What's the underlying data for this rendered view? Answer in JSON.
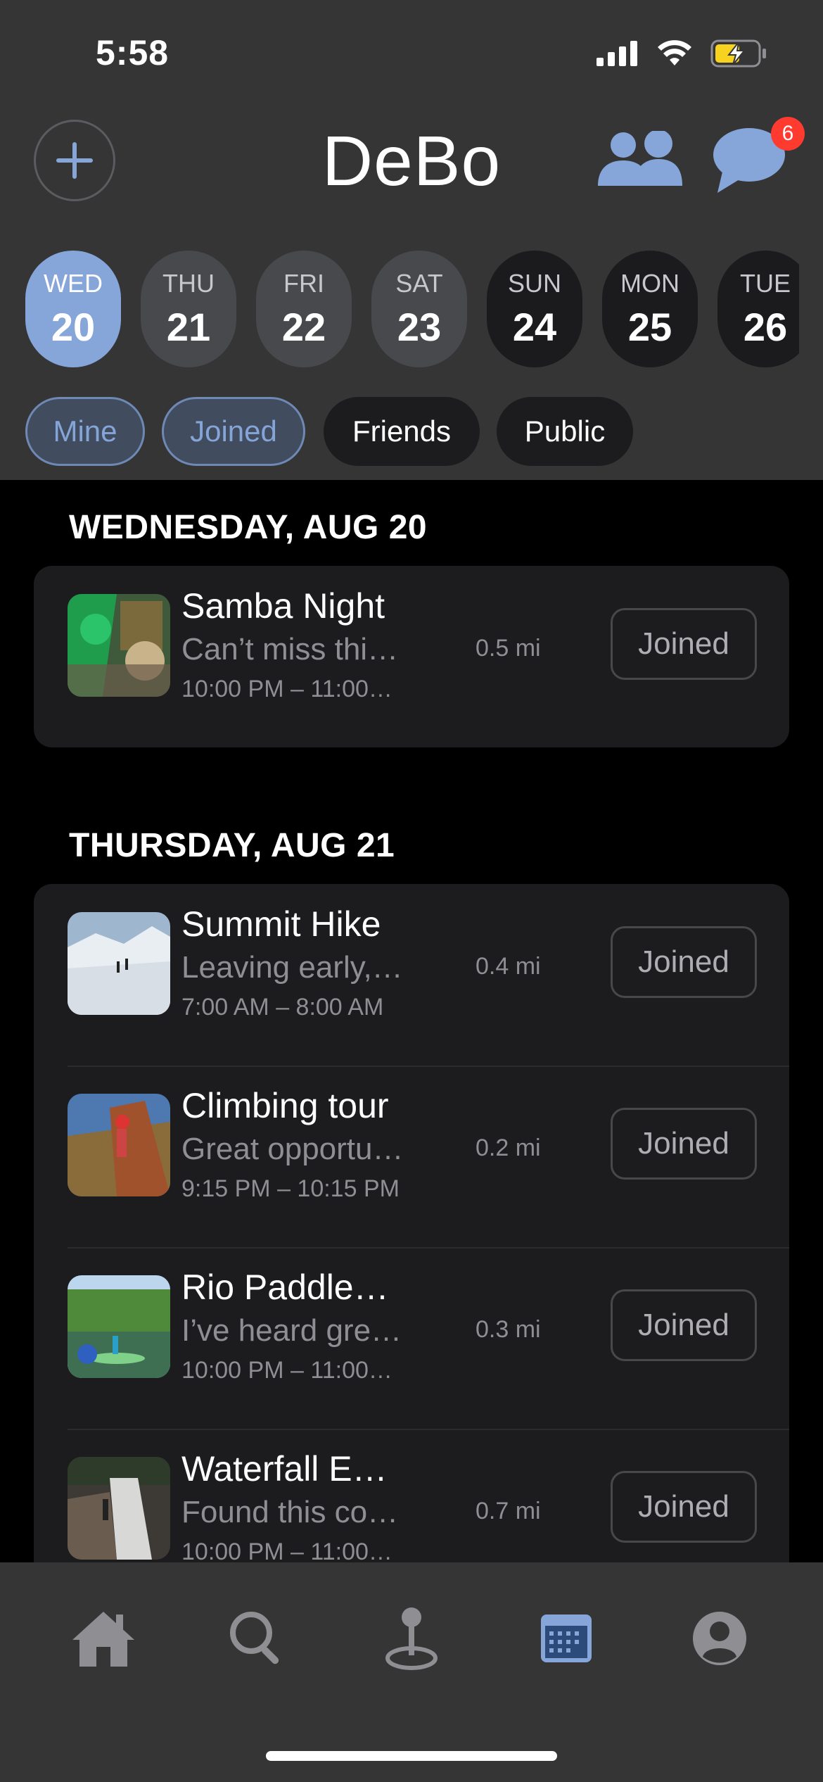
{
  "status_bar": {
    "time": "5:58"
  },
  "header": {
    "title": "DeBo",
    "message_badge": "6"
  },
  "days": [
    {
      "dow": "WED",
      "num": "20"
    },
    {
      "dow": "THU",
      "num": "21"
    },
    {
      "dow": "FRI",
      "num": "22"
    },
    {
      "dow": "SAT",
      "num": "23"
    },
    {
      "dow": "SUN",
      "num": "24"
    },
    {
      "dow": "MON",
      "num": "25"
    },
    {
      "dow": "TUE",
      "num": "26"
    }
  ],
  "filters": [
    "Mine",
    "Joined",
    "Friends",
    "Public"
  ],
  "sections": [
    {
      "title": "WEDNESDAY, AUG 20",
      "events": [
        {
          "title": "Samba Night",
          "desc": "Can’t miss thi…",
          "time": "10:00 PM – 11:00…",
          "distance": "0.5 mi",
          "status": "Joined"
        }
      ]
    },
    {
      "title": "THURSDAY, AUG 21",
      "events": [
        {
          "title": "Summit Hike",
          "desc": "Leaving early,…",
          "time": "7:00 AM – 8:00 AM",
          "distance": "0.4 mi",
          "status": "Joined"
        },
        {
          "title": "Climbing tour",
          "desc": "Great opportu…",
          "time": "9:15 PM – 10:15 PM",
          "distance": "0.2 mi",
          "status": "Joined"
        },
        {
          "title": "Rio Paddle…",
          "desc": "I’ve heard gre…",
          "time": "10:00 PM – 11:00…",
          "distance": "0.3 mi",
          "status": "Joined"
        },
        {
          "title": "Waterfall E…",
          "desc": "Found this co…",
          "time": "10:00 PM – 11:00…",
          "distance": "0.7 mi",
          "status": "Joined"
        }
      ]
    }
  ],
  "colors": {
    "accent": "#86a6da",
    "header_bg": "#353536",
    "card_bg": "#1c1c1e",
    "badge": "#ff3b30"
  },
  "tabs": [
    "home-icon",
    "search-icon",
    "map-pin-icon",
    "calendar-icon",
    "profile-icon"
  ]
}
